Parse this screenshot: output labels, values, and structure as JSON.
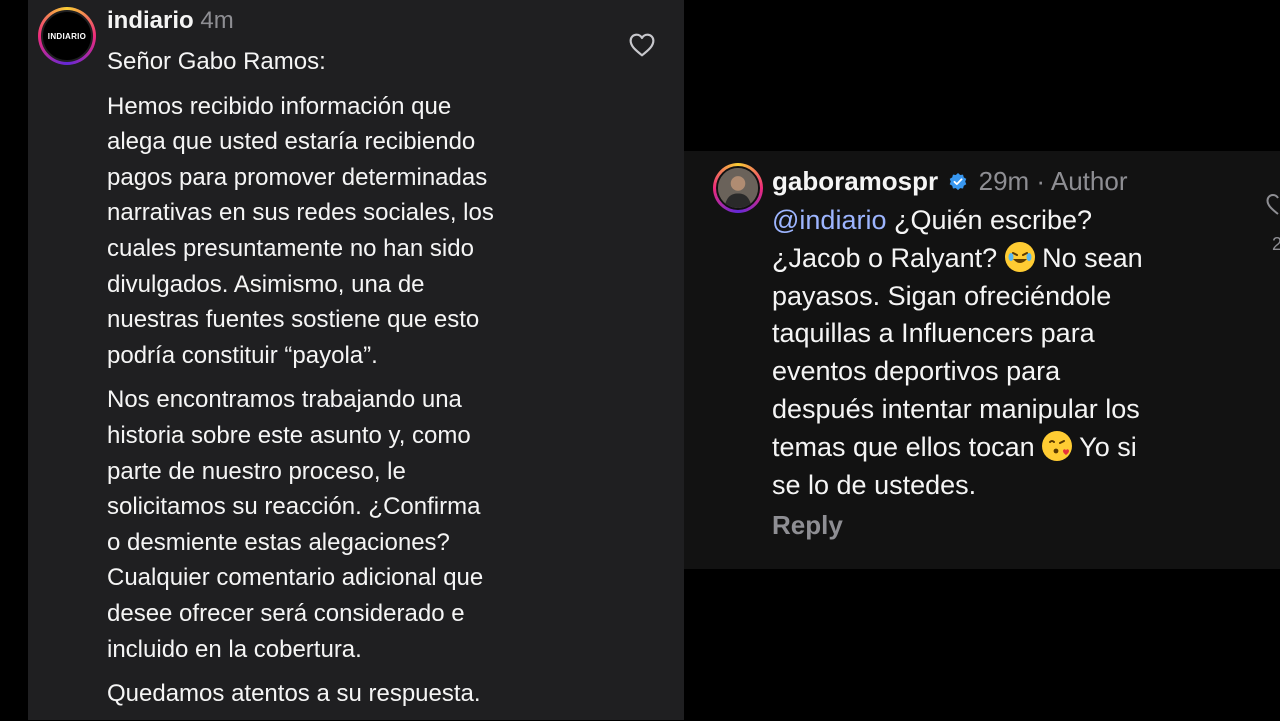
{
  "left_comment": {
    "username": "indiario",
    "time": "4m",
    "avatar_logo": "INDIARIO",
    "icon": "heart-icon",
    "paragraphs": [
      "Señor Gabo Ramos:",
      "Hemos recibido información que\nalega que usted estaría recibiendo\npagos para promover determinadas\nnarrativas en sus redes sociales, los\ncuales presuntamente no han sido\ndivulgados. Asimismo, una de\nnuestras fuentes sostiene que esto\npodría constituir “payola”.",
      "Nos encontramos trabajando una\nhistoria sobre este asunto y, como\nparte de nuestro proceso, le\nsolicitamos su reacción. ¿Confirma\no desmiente estas alegaciones?\nCualquier comentario adicional que\ndesee ofrecer será considerado e\nincluido en la cobertura.",
      "Quedamos atentos a su respuesta."
    ]
  },
  "right_comment": {
    "username": "gaboramospr",
    "verified_icon": "verified-badge-icon",
    "meta": "29m · Author",
    "mention": "@indiario",
    "text_1": " ¿Quién escribe?\n¿Jacob o Ralyant? ",
    "emoji_1": "rolling-on-floor-laughing-emoji",
    "text_2": " No sean\npayasos. Sigan ofreciéndole\ntaquillas a Influencers para\neventos deportivos para\ndespués intentar manipular los\ntemas que ellos tocan ",
    "emoji_2": "face-blowing-kiss-emoji",
    "text_3": " Yo si\nse lo de ustedes.",
    "reply_label": "Reply"
  },
  "colors": {
    "left_bg": "#1f1f21",
    "right_bg": "#121212",
    "mention": "#9db5ff",
    "muted": "#8e8e93",
    "verified": "#3897f0"
  }
}
